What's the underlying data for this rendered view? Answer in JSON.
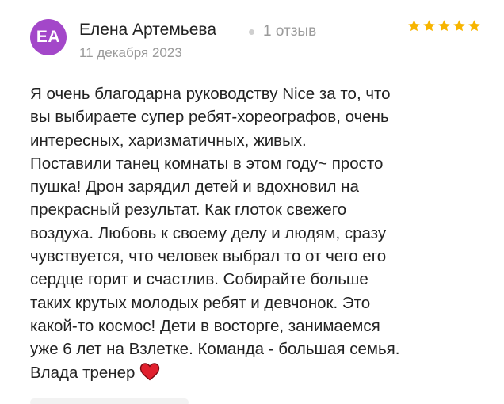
{
  "review": {
    "avatar": {
      "initials": "ЕА",
      "color": "#a347c9"
    },
    "author_name": "Елена Артемьева",
    "review_count": "1 отзыв",
    "date": "11 декабря 2023",
    "rating": 5,
    "rating_max": 5,
    "star_color": "#f7b500",
    "text_lines": [
      "Я очень благодарна руководству Nice за то, что",
      "вы выбираете супер ребят-хореографов, очень",
      "интересных, харизматичных, живых.",
      "Поставили танец комнаты в этом году~ просто",
      "пушка! Дрон зарядил детей и вдохновил на",
      "прекрасный результат. Как глоток свежего",
      "воздуха. Любовь к своему делу и людям, сразу",
      "чувствуется, что человек выбрал то от чего его",
      "сердце горит и счастлив. Собирайте больше",
      "таких крутых молодых ребят и девчонок. Это",
      "какой-то космос! Дети в восторге, занимаемся",
      "уже 6 лет на Взлетке. Команда - большая семья.",
      "Влада тренер"
    ],
    "trailing_emoji": "heart-icon",
    "heart_color": "#e0202e"
  }
}
